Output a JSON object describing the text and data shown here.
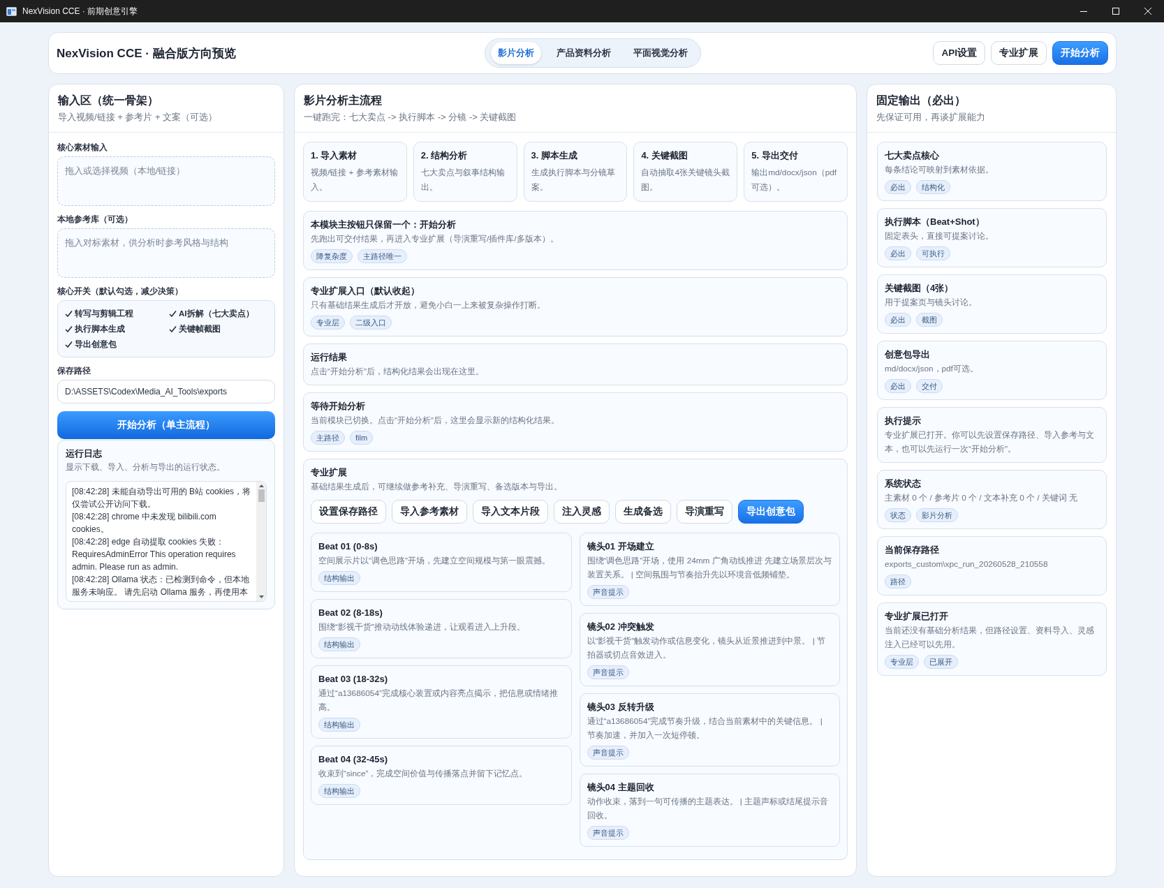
{
  "window": {
    "title": "NexVision CCE · 前期创意引擎"
  },
  "header": {
    "title": "NexVision CCE · 融合版方向预览",
    "tabs": [
      {
        "label": "影片分析",
        "selected": true
      },
      {
        "label": "产品资料分析",
        "selected": false
      },
      {
        "label": "平面视觉分析",
        "selected": false
      }
    ],
    "buttons": [
      {
        "label": "API设置",
        "kind": "secondary"
      },
      {
        "label": "专业扩展",
        "kind": "secondary"
      },
      {
        "label": "开始分析",
        "kind": "primary"
      }
    ]
  },
  "input_panel": {
    "title": "输入区（统一骨架）",
    "subtitle": "导入视频/链接 + 参考片 + 文案（可选）",
    "core_input": {
      "label": "核心素材输入",
      "placeholder": "拖入或选择视频（本地/链接）"
    },
    "reference_library": {
      "label": "本地参考库（可选）",
      "placeholder": "拖入对标素材，供分析时参考风格与结构"
    },
    "switches": {
      "label": "核心开关（默认勾选，减少决策）",
      "items": [
        {
          "label": "转写与剪辑工程",
          "checked": true
        },
        {
          "label": "AI拆解（七大卖点）",
          "checked": true
        },
        {
          "label": "执行脚本生成",
          "checked": true
        },
        {
          "label": "关键帧截图",
          "checked": true
        },
        {
          "label": "导出创意包",
          "checked": true
        }
      ]
    },
    "save_path": {
      "label": "保存路径",
      "value": "D:\\ASSETS\\Codex\\Media_AI_Tools\\exports"
    },
    "run_button": "开始分析（单主流程）",
    "log": {
      "title": "运行日志",
      "subtitle": "显示下载、导入、分析与导出的运行状态。",
      "lines": [
        "[08:42:28] 未能自动导出可用的 B站 cookies，将仅尝试公开访问下载。",
        "[08:42:28] chrome 中未发现 bilibili.com cookies。",
        "[08:42:28] edge 自动提取 cookies 失败：RequiresAdminError This operation requires admin. Please run as admin.",
        "[08:42:28] Ollama 状态：已检测到命令，但本地服务未响应。 请先启动 Ollama 服务，再使用本"
      ]
    }
  },
  "main_flow": {
    "title": "影片分析主流程",
    "subtitle": "一键跑完：七大卖点 -> 执行脚本 -> 分镜 -> 关键截图",
    "steps": [
      {
        "title": "1. 导入素材",
        "description": "视频/链接 + 参考素材输入。"
      },
      {
        "title": "2. 结构分析",
        "description": "七大卖点与叙事结构输出。"
      },
      {
        "title": "3. 脚本生成",
        "description": "生成执行脚本与分镜草案。"
      },
      {
        "title": "4. 关键截图",
        "description": "自动抽取4张关键镜头截图。"
      },
      {
        "title": "5. 导出交付",
        "description": "输出md/docx/json（pdf可选）。"
      }
    ],
    "cards": [
      {
        "title": "本模块主按钮只保留一个：开始分析",
        "description": "先跑出可交付结果，再进入专业扩展（导演重写/插件库/多版本）。",
        "tags": [
          "降复杂度",
          "主路径唯一"
        ]
      },
      {
        "title": "专业扩展入口（默认收起）",
        "description": "只有基础结果生成后才开放，避免小白一上来被复杂操作打断。",
        "tags": [
          "专业层",
          "二级入口"
        ]
      },
      {
        "title": "运行结果",
        "description": "点击“开始分析”后，结构化结果会出现在这里。"
      },
      {
        "title": "等待开始分析",
        "description": "当前模块已切换。点击“开始分析”后，这里会显示新的结构化结果。",
        "tags": [
          "主路径",
          "film"
        ]
      }
    ],
    "expansion": {
      "title": "专业扩展",
      "description": "基础结果生成后，可继续做参考补充、导演重写、备选版本与导出。",
      "buttons": [
        {
          "label": "设置保存路径",
          "kind": "secondary"
        },
        {
          "label": "导入参考素材",
          "kind": "secondary"
        },
        {
          "label": "导入文本片段",
          "kind": "secondary"
        },
        {
          "label": "注入灵感",
          "kind": "secondary"
        },
        {
          "label": "生成备选",
          "kind": "secondary"
        },
        {
          "label": "导演重写",
          "kind": "secondary"
        },
        {
          "label": "导出创意包",
          "kind": "primary"
        }
      ],
      "beats": [
        {
          "title": "Beat 01 (0-8s)",
          "description": "空间展示片以“调色思路”开场，先建立空间规模与第一眼震撼。",
          "tags": [
            "结构输出"
          ]
        },
        {
          "title": "Beat 02 (8-18s)",
          "description": "围绕“影视干货”推动动线体验递进，让观看进入上升段。",
          "tags": [
            "结构输出"
          ]
        },
        {
          "title": "Beat 03 (18-32s)",
          "description": "通过“a13686054”完成核心装置或内容亮点揭示，把信息或情绪推高。",
          "tags": [
            "结构输出"
          ]
        },
        {
          "title": "Beat 04 (32-45s)",
          "description": "收束到“since”，完成空间价值与传播落点并留下记忆点。",
          "tags": [
            "结构输出"
          ]
        }
      ],
      "shots": [
        {
          "title": "镜头01 开场建立",
          "description": "围绕“调色思路”开场，使用 24mm 广角动线推进 先建立场景层次与装置关系。 | 空间氛围与节奏抬升先以环境音低频铺垫。",
          "tags": [
            "声音提示"
          ]
        },
        {
          "title": "镜头02 冲突触发",
          "description": "以“影视干货”触发动作或信息变化，镜头从近景推进到中景。 | 节拍器或切点音效进入。",
          "tags": [
            "声音提示"
          ]
        },
        {
          "title": "镜头03 反转升级",
          "description": "通过“a13686054”完成节奏升级，结合当前素材中的关键信息。 | 节奏加速，并加入一次短停顿。",
          "tags": [
            "声音提示"
          ]
        },
        {
          "title": "镜头04 主题回收",
          "description": "动作收束，落到一句可传播的主题表达。 | 主题声标或结尾提示音回收。",
          "tags": [
            "声音提示"
          ]
        }
      ]
    }
  },
  "fixed_output": {
    "title": "固定输出（必出）",
    "subtitle": "先保证可用，再谈扩展能力",
    "cards": [
      {
        "title": "七大卖点核心",
        "description": "每条结论可映射到素材依据。",
        "tags": [
          "必出",
          "结构化"
        ]
      },
      {
        "title": "执行脚本（Beat+Shot）",
        "description": "固定表头，直接可提案讨论。",
        "tags": [
          "必出",
          "可执行"
        ]
      },
      {
        "title": "关键截图（4张）",
        "description": "用于提案页与镜头讨论。",
        "tags": [
          "必出",
          "截图"
        ]
      },
      {
        "title": "创意包导出",
        "description": "md/docx/json，pdf可选。",
        "tags": [
          "必出",
          "交付"
        ]
      },
      {
        "title": "执行提示",
        "description": "专业扩展已打开。你可以先设置保存路径、导入参考与文本，也可以先运行一次“开始分析”。"
      },
      {
        "title": "系统状态",
        "description": "主素材 0 个 / 参考片 0 个 / 文本补充 0 个 / 关键词 无",
        "tags": [
          "状态",
          "影片分析"
        ]
      },
      {
        "title": "当前保存路径",
        "description": "exports_custom\\xpc_run_20260528_210558",
        "tags": [
          "路径"
        ]
      },
      {
        "title": "专业扩展已打开",
        "description": "当前还没有基础分析结果，但路径设置、资料导入、灵感注入已经可以先用。",
        "tags": [
          "专业层",
          "已展开"
        ]
      }
    ]
  }
}
